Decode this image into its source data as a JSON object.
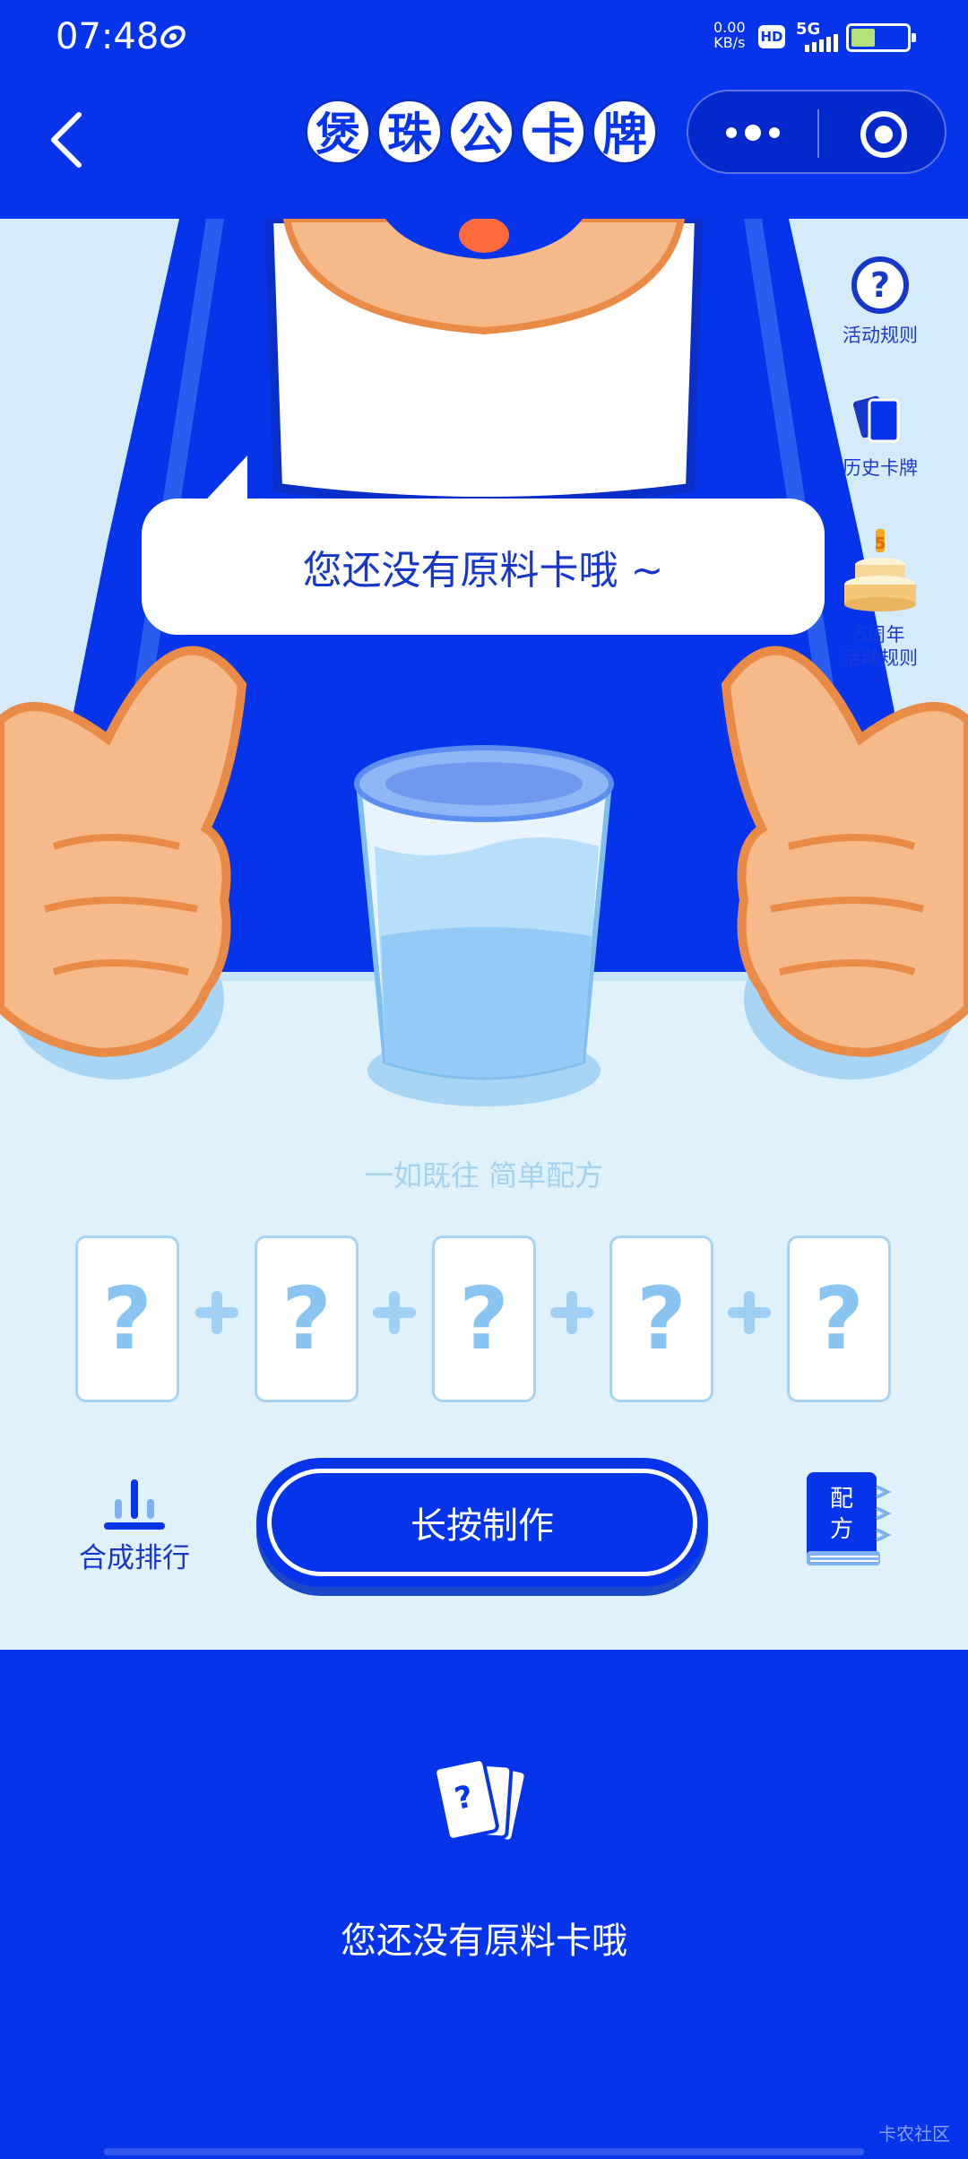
{
  "status_bar": {
    "time": "07:48",
    "net_speed_value": "0.00",
    "net_speed_unit": "KB/s",
    "hd_badge": "HD",
    "network": "5G"
  },
  "nav": {
    "title_chars": [
      "煲",
      "珠",
      "公",
      "卡",
      "牌"
    ]
  },
  "side_menu": {
    "rules": "活动规则",
    "history": "历史卡牌",
    "anniv_line1": "5周年",
    "anniv_line2": "活动规则"
  },
  "bubble_text": "您还没有原料卡哦 ~",
  "slogan": "一如既往 简单配方",
  "recipe_cards": [
    "?",
    "?",
    "?",
    "?",
    "?"
  ],
  "ranking_label": "合成排行",
  "make_button": "长按制作",
  "recipe_book": {
    "line1": "配",
    "line2": "方"
  },
  "empty_state": {
    "card_glyph": "?",
    "text": "您还没有原料卡哦"
  },
  "watermark": "卡农社区",
  "colors": {
    "brand_blue": "#0534ea",
    "light_bg": "#dff1fb",
    "card_border": "#a8d4f3"
  }
}
